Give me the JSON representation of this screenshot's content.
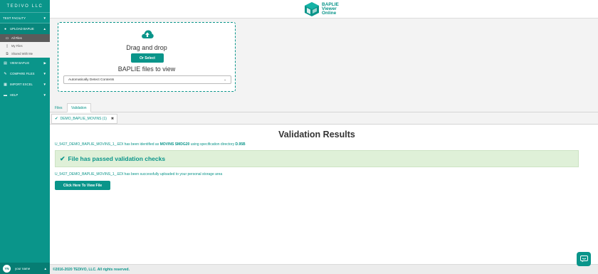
{
  "brand": "TEDIVO LLC",
  "facility": "TEST FACILITY",
  "sidebar": {
    "upload": "UPLOAD BAPLIE",
    "sub_items": [
      "All Files",
      "My Files",
      "Shared With Me"
    ],
    "view": "VIEW BAPLIE",
    "compare": "COMPARE FILES",
    "import": "IMPORT EXCEL",
    "help": "HELP"
  },
  "user": {
    "initials": "YN",
    "name": "your name"
  },
  "logo": {
    "line1": "BAPLIE",
    "line2": "Viewer",
    "line3": "Online"
  },
  "upload": {
    "drag": "Drag and drop",
    "or_select": "Or Select",
    "files_to_view": "BAPLIE files to view",
    "select_value": "Automatically Detect Contents"
  },
  "tabs": [
    "Files",
    "Validation"
  ],
  "file_tab": "DEMO_BAPLIE_MOVINS (1)",
  "validation": {
    "title": "Validation Results",
    "file_name": "U_5427_DEMO_BAPLIE_MOVINS_1_.EDI",
    "identified_text": "has been identified as",
    "spec": "MOVINS SMDG20",
    "dir_text": "using specification directory",
    "dir": "D.95B",
    "passed": "File has passed validation checks",
    "uploaded": "U_5427_DEMO_BAPLIE_MOVINS_1_.EDI has been successfully uploaded to your personal storage area",
    "view_button": "Click Here To View File"
  },
  "footer": "©2016-2020 TEDIVO, LLC. All rights reserved.",
  "colors": {
    "accent": "#0a958a",
    "success_bg": "#dff0d8"
  }
}
